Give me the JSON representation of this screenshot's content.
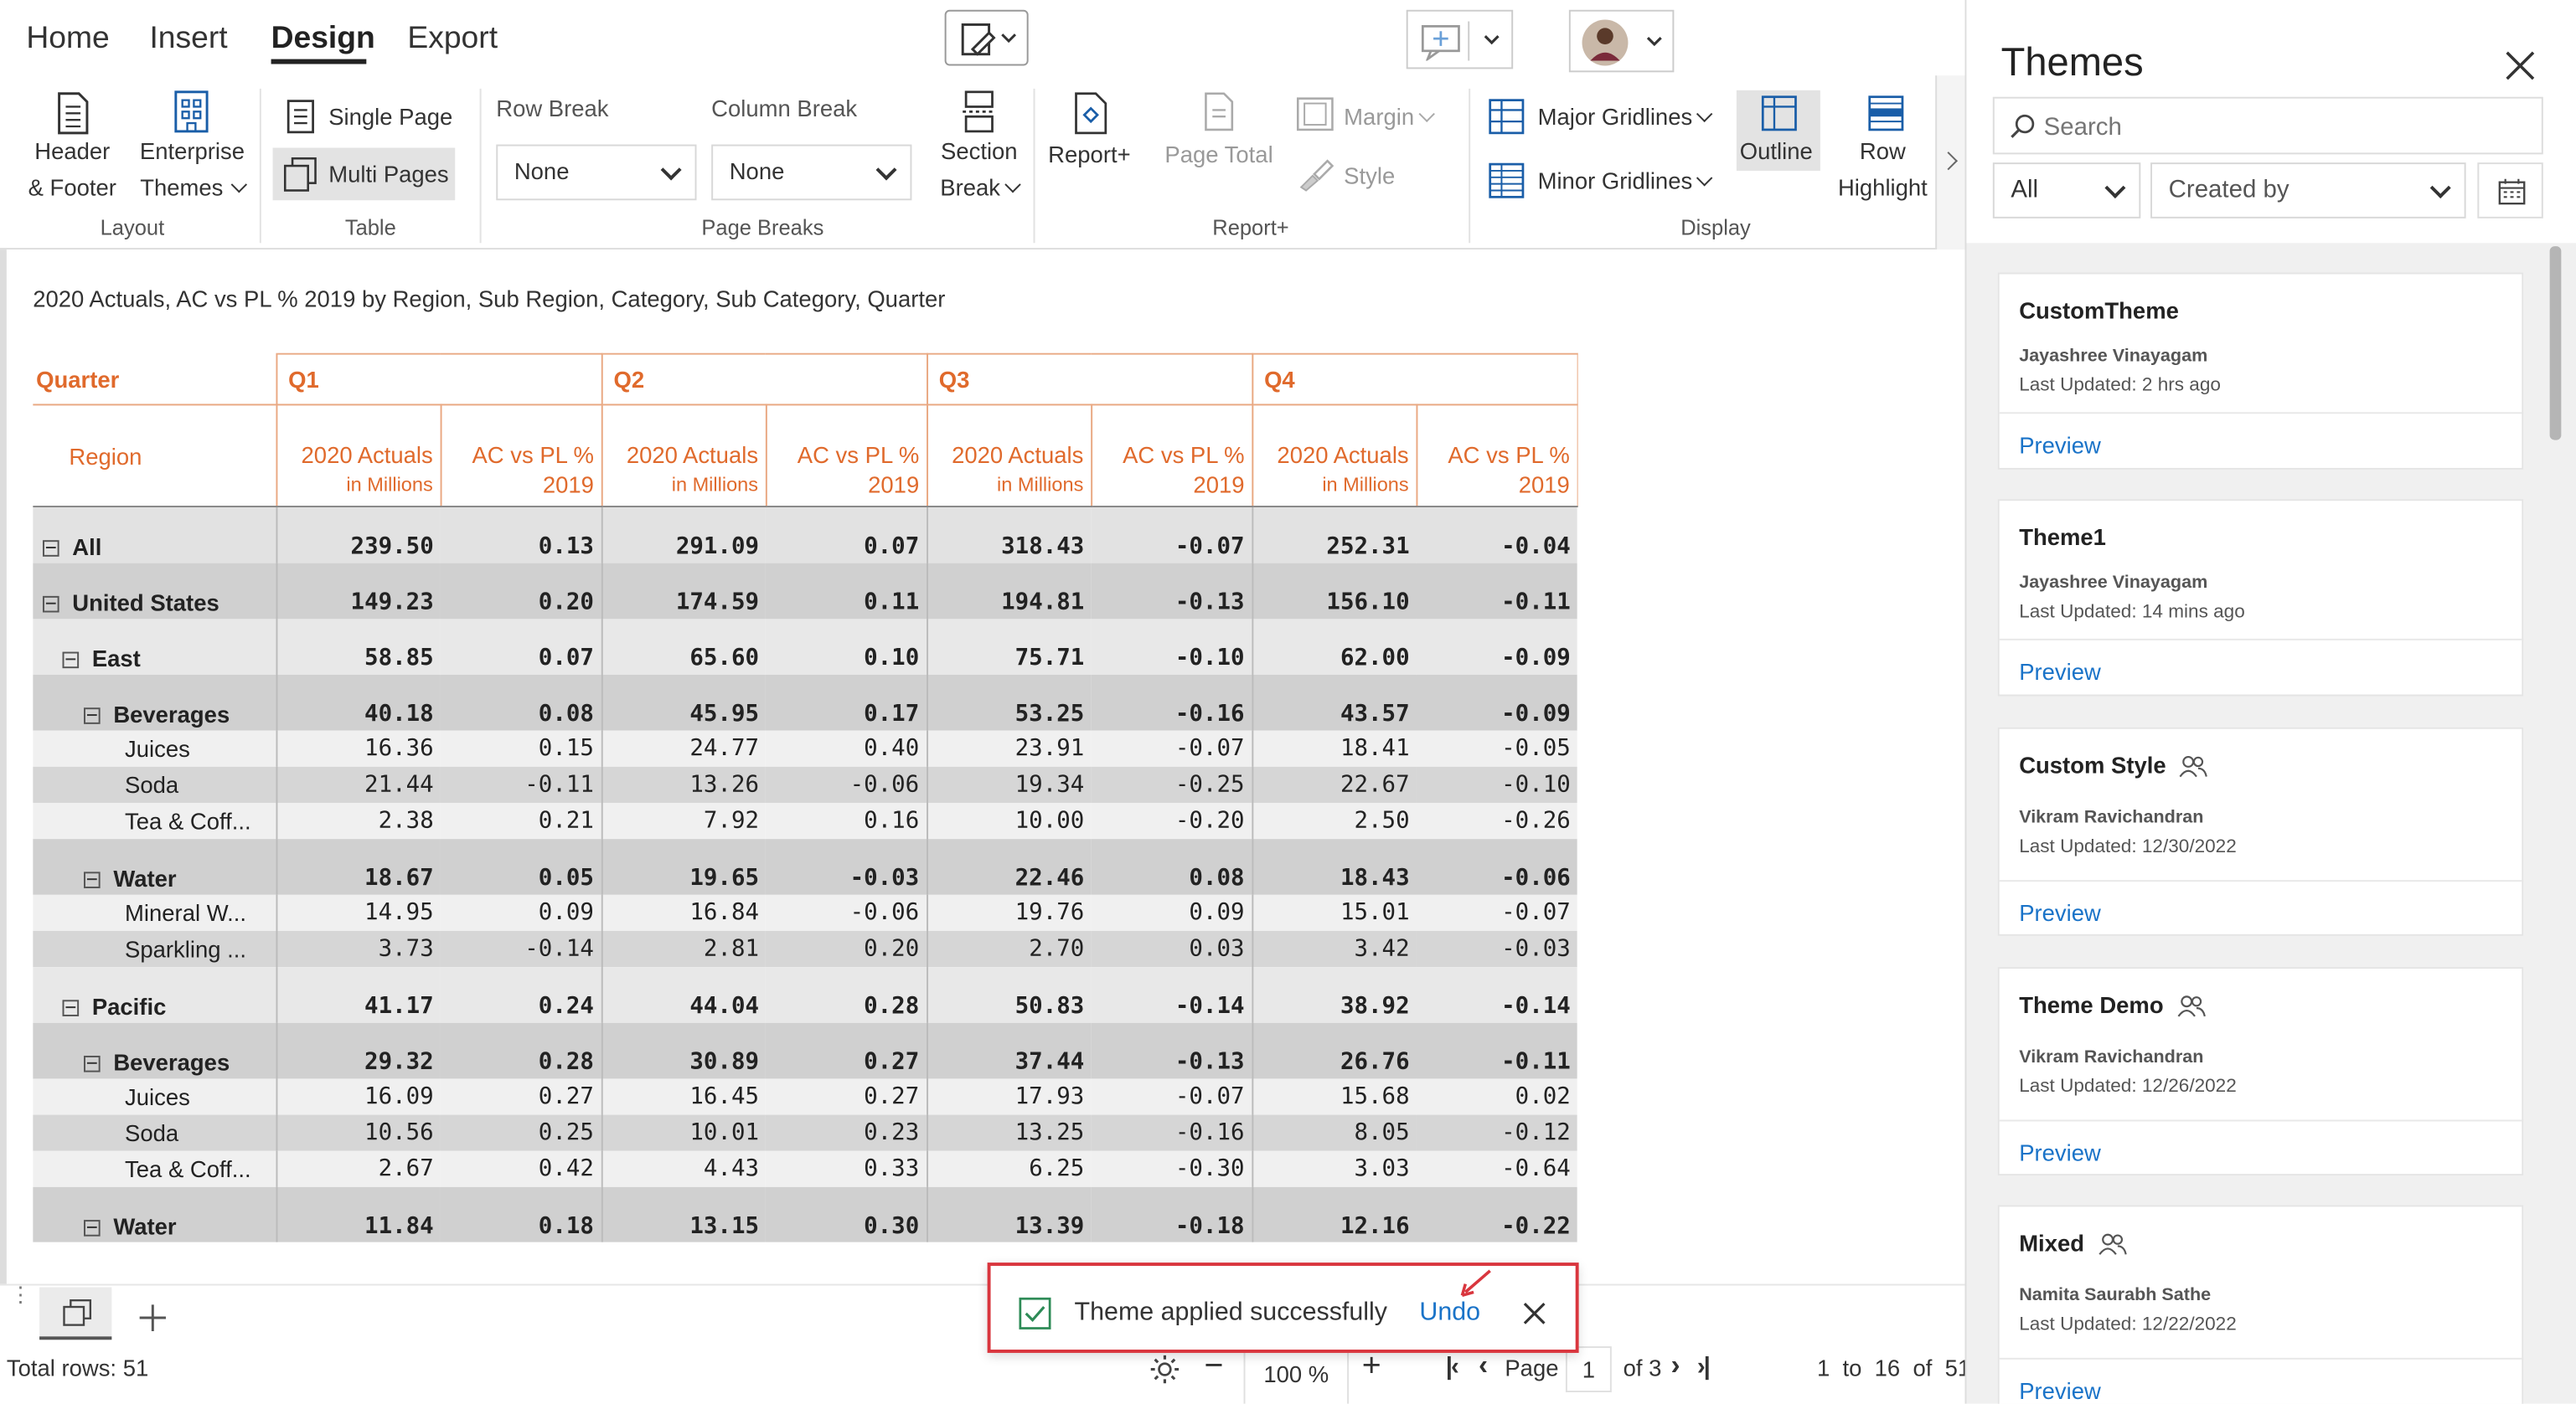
{
  "menu": {
    "home": "Home",
    "insert": "Insert",
    "design": "Design",
    "export": "Export"
  },
  "ribbon": {
    "header_footer": [
      "Header",
      "& Footer"
    ],
    "enterprise_themes": [
      "Enterprise",
      "Themes"
    ],
    "layout_group": "Layout",
    "single_page": "Single Page",
    "multi_pages": "Multi Pages",
    "table_group": "Table",
    "row_break_label": "Row Break",
    "row_break_value": "None",
    "column_break_label": "Column Break",
    "column_break_value": "None",
    "section_break": [
      "Section",
      "Break"
    ],
    "page_breaks_group": "Page Breaks",
    "report_plus": "Report+",
    "page_total": "Page Total",
    "margin": "Margin",
    "style": "Style",
    "report_plus_group": "Report+",
    "major_gridlines": "Major Gridlines",
    "minor_gridlines": "Minor Gridlines",
    "outline": "Outline",
    "row_highlight": [
      "Row",
      "Highlight"
    ],
    "display_group": "Display"
  },
  "report": {
    "title": "2020 Actuals, AC vs PL % 2019 by Region, Sub Region, Category, Sub Category, Quarter",
    "quarter_label": "Quarter",
    "region_label": "Region",
    "quarters": [
      "Q1",
      "Q2",
      "Q3",
      "Q4"
    ],
    "measure1": [
      "2020 Actuals",
      "in Millions"
    ],
    "measure2": [
      "AC vs PL %",
      "2019"
    ],
    "rows": [
      {
        "label": "All",
        "type": "all",
        "v": [
          "239.50",
          "0.13",
          "291.09",
          "0.07",
          "318.43",
          "-0.07",
          "252.31",
          "-0.04"
        ]
      },
      {
        "label": "United States",
        "type": "us",
        "v": [
          "149.23",
          "0.20",
          "174.59",
          "0.11",
          "194.81",
          "-0.13",
          "156.10",
          "-0.11"
        ]
      },
      {
        "label": "East",
        "type": "reg",
        "v": [
          "58.85",
          "0.07",
          "65.60",
          "0.10",
          "75.71",
          "-0.10",
          "62.00",
          "-0.09"
        ]
      },
      {
        "label": "Beverages",
        "type": "cat",
        "v": [
          "40.18",
          "0.08",
          "45.95",
          "0.17",
          "53.25",
          "-0.16",
          "43.57",
          "-0.09"
        ]
      },
      {
        "label": "Juices",
        "type": "l1",
        "v": [
          "16.36",
          "0.15",
          "24.77",
          "0.40",
          "23.91",
          "-0.07",
          "18.41",
          "-0.05"
        ]
      },
      {
        "label": "Soda",
        "type": "l2",
        "v": [
          "21.44",
          "-0.11",
          "13.26",
          "-0.06",
          "19.34",
          "-0.25",
          "22.67",
          "-0.10"
        ]
      },
      {
        "label": "Tea & Coff...",
        "type": "l1",
        "v": [
          "2.38",
          "0.21",
          "7.92",
          "0.16",
          "10.00",
          "-0.20",
          "2.50",
          "-0.26"
        ]
      },
      {
        "label": "Water",
        "type": "cat",
        "v": [
          "18.67",
          "0.05",
          "19.65",
          "-0.03",
          "22.46",
          "0.08",
          "18.43",
          "-0.06"
        ]
      },
      {
        "label": "Mineral W...",
        "type": "l1",
        "v": [
          "14.95",
          "0.09",
          "16.84",
          "-0.06",
          "19.76",
          "0.09",
          "15.01",
          "-0.07"
        ]
      },
      {
        "label": "Sparkling ...",
        "type": "l2",
        "v": [
          "3.73",
          "-0.14",
          "2.81",
          "0.20",
          "2.70",
          "0.03",
          "3.42",
          "-0.03"
        ]
      },
      {
        "label": "Pacific",
        "type": "reg",
        "v": [
          "41.17",
          "0.24",
          "44.04",
          "0.28",
          "50.83",
          "-0.14",
          "38.92",
          "-0.14"
        ]
      },
      {
        "label": "Beverages",
        "type": "cat",
        "v": [
          "29.32",
          "0.28",
          "30.89",
          "0.27",
          "37.44",
          "-0.13",
          "26.76",
          "-0.11"
        ]
      },
      {
        "label": "Juices",
        "type": "l1",
        "v": [
          "16.09",
          "0.27",
          "16.45",
          "0.27",
          "17.93",
          "-0.07",
          "15.68",
          "0.02"
        ]
      },
      {
        "label": "Soda",
        "type": "l2",
        "v": [
          "10.56",
          "0.25",
          "10.01",
          "0.23",
          "13.25",
          "-0.16",
          "8.05",
          "-0.12"
        ]
      },
      {
        "label": "Tea & Coff...",
        "type": "l1",
        "v": [
          "2.67",
          "0.42",
          "4.43",
          "0.33",
          "6.25",
          "-0.30",
          "3.03",
          "-0.64"
        ]
      },
      {
        "label": "Water",
        "type": "cat",
        "v": [
          "11.84",
          "0.18",
          "13.15",
          "0.30",
          "13.39",
          "-0.18",
          "12.16",
          "-0.22"
        ]
      }
    ]
  },
  "footer": {
    "total_rows": "Total rows: 51",
    "zoom": "100 %",
    "page_label": "Page",
    "page_value": "1",
    "of_pages": "of 3",
    "range": "1  to  16  of  51"
  },
  "toast": {
    "message": "Theme applied successfully",
    "undo": "Undo"
  },
  "themes": {
    "title": "Themes",
    "search_placeholder": "Search",
    "filter_all": "All",
    "filter_created": "Created by",
    "preview": "Preview",
    "items": [
      {
        "name": "CustomTheme",
        "author": "Jayashree Vinayagam",
        "updated": "Last Updated: 2 hrs ago",
        "shared": false
      },
      {
        "name": "Theme1",
        "author": "Jayashree Vinayagam",
        "updated": "Last Updated: 14 mins ago",
        "shared": false
      },
      {
        "name": "Custom Style",
        "author": "Vikram Ravichandran",
        "updated": "Last Updated: 12/30/2022",
        "shared": true
      },
      {
        "name": "Theme Demo",
        "author": "Vikram Ravichandran",
        "updated": "Last Updated: 12/26/2022",
        "shared": true
      },
      {
        "name": "Mixed",
        "author": "Namita Saurabh Sathe",
        "updated": "Last Updated: 12/22/2022",
        "shared": true
      }
    ]
  },
  "colors": {
    "accent_orange": "#e06a2c",
    "link_blue": "#1a73c8",
    "toast_border": "#d9363e",
    "toast_check": "#2e8b57"
  }
}
